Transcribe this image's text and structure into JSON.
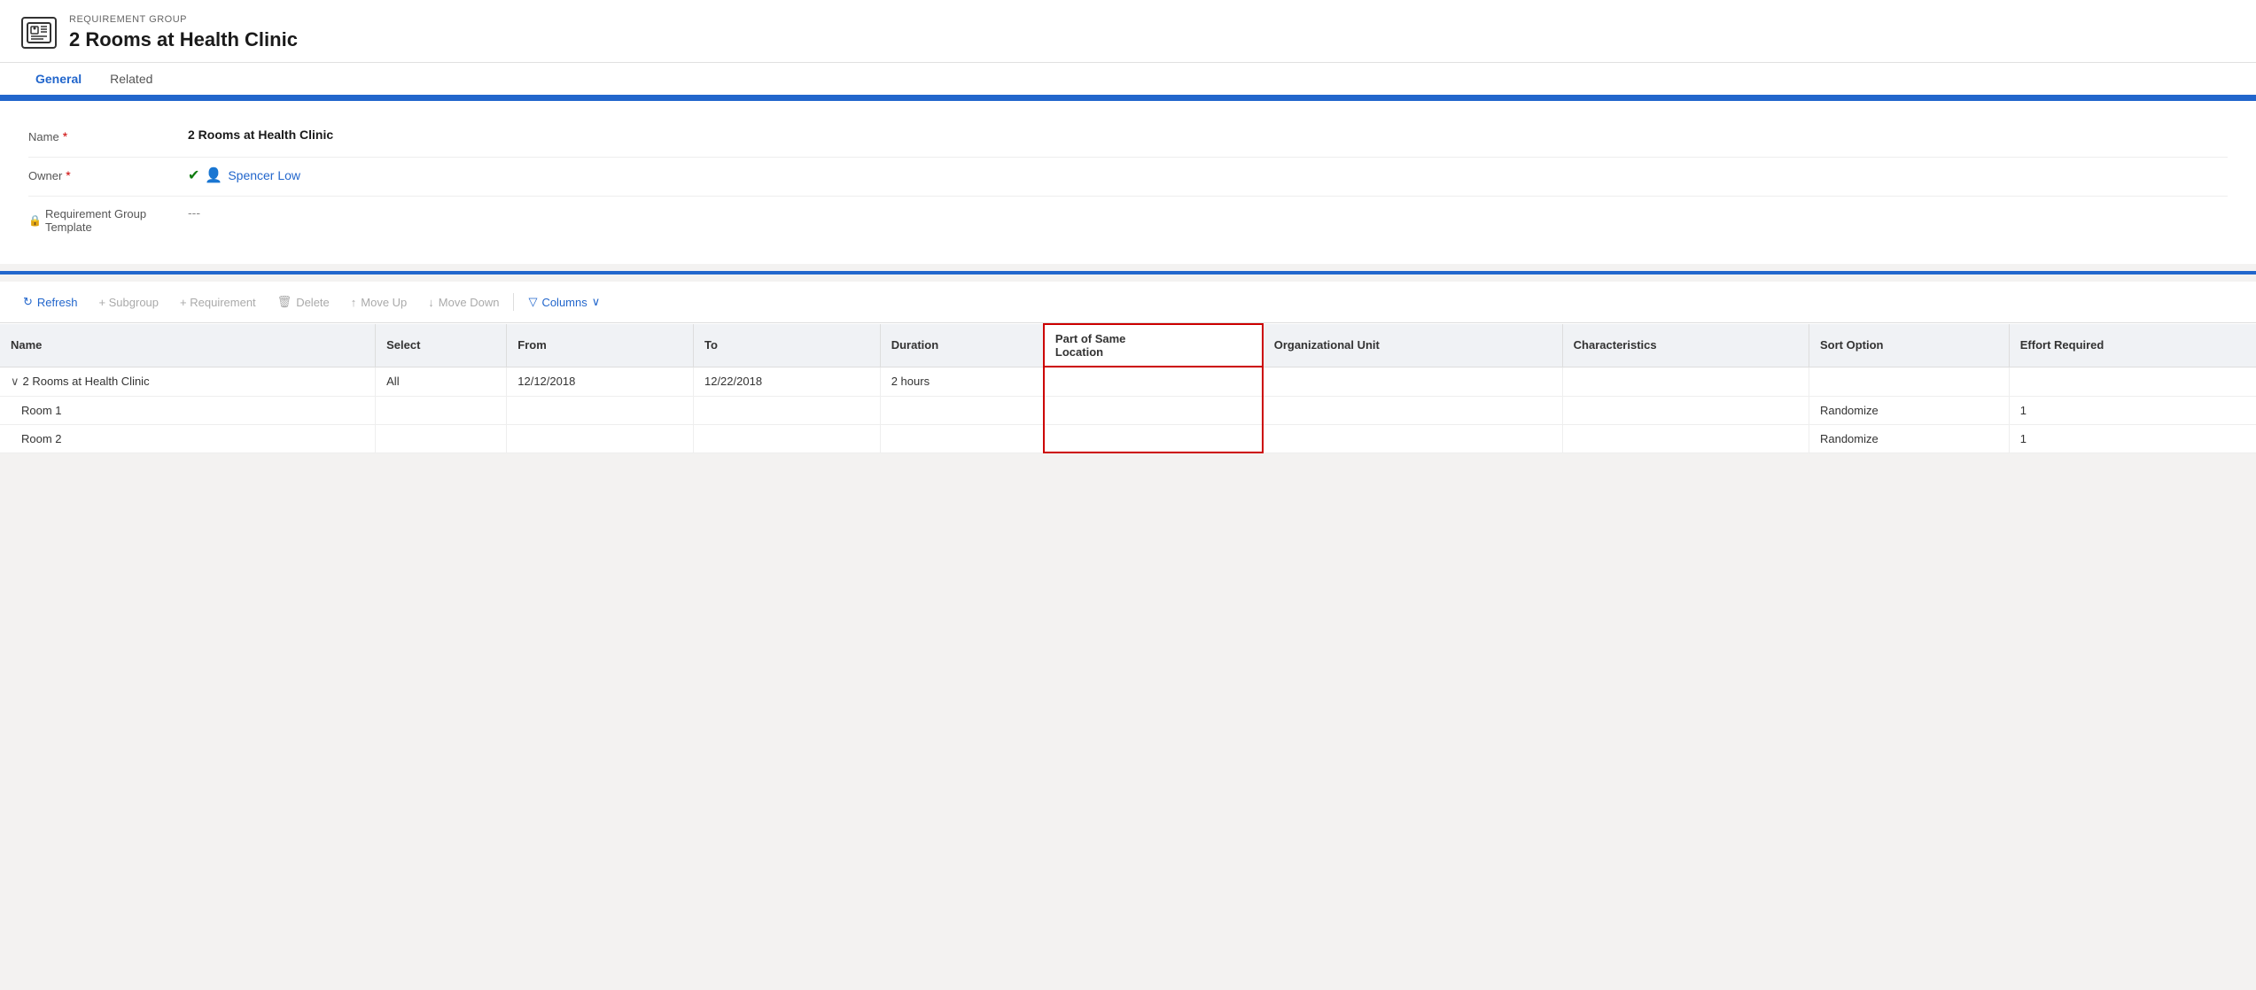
{
  "header": {
    "subtitle": "REQUIREMENT GROUP",
    "title": "2 Rooms at Health Clinic",
    "icon_text": "R="
  },
  "tabs": [
    {
      "label": "General",
      "active": true
    },
    {
      "label": "Related",
      "active": false
    }
  ],
  "form": {
    "fields": [
      {
        "label": "Name",
        "required": true,
        "value": "2 Rooms at Health Clinic",
        "type": "text",
        "locked": false
      },
      {
        "label": "Owner",
        "required": true,
        "value": "Spencer Low",
        "type": "link",
        "locked": false
      },
      {
        "label": "Requirement Group Template",
        "required": false,
        "value": "---",
        "type": "muted",
        "locked": true
      }
    ]
  },
  "toolbar": {
    "refresh_label": "Refresh",
    "subgroup_label": "+ Subgroup",
    "requirement_label": "+ Requirement",
    "delete_label": "Delete",
    "move_up_label": "Move Up",
    "move_down_label": "Move Down",
    "columns_label": "Columns"
  },
  "table": {
    "columns": [
      {
        "key": "name",
        "label": "Name",
        "highlighted": false
      },
      {
        "key": "select",
        "label": "Select",
        "highlighted": false
      },
      {
        "key": "from",
        "label": "From",
        "highlighted": false
      },
      {
        "key": "to",
        "label": "To",
        "highlighted": false
      },
      {
        "key": "duration",
        "label": "Duration",
        "highlighted": false
      },
      {
        "key": "part_of_same",
        "label": "Part of Same\nLocation",
        "highlighted": true
      },
      {
        "key": "org_unit",
        "label": "Organizational Unit",
        "highlighted": false
      },
      {
        "key": "characteristics",
        "label": "Characteristics",
        "highlighted": false
      },
      {
        "key": "sort_option",
        "label": "Sort Option",
        "highlighted": false
      },
      {
        "key": "effort_required",
        "label": "Effort Required",
        "highlighted": false
      }
    ],
    "rows": [
      {
        "name": "2 Rooms at Health Clinic",
        "indent": false,
        "chevron": true,
        "select": "All",
        "from": "12/12/2018",
        "to": "12/22/2018",
        "duration": "2 hours",
        "part_of_same": "",
        "org_unit": "",
        "characteristics": "",
        "sort_option": "",
        "effort_required": ""
      },
      {
        "name": "Room 1",
        "indent": true,
        "chevron": false,
        "select": "",
        "from": "",
        "to": "",
        "duration": "",
        "part_of_same": "",
        "org_unit": "",
        "characteristics": "",
        "sort_option": "Randomize",
        "effort_required": "1"
      },
      {
        "name": "Room 2",
        "indent": true,
        "chevron": false,
        "select": "",
        "from": "",
        "to": "",
        "duration": "",
        "part_of_same": "",
        "org_unit": "",
        "characteristics": "",
        "sort_option": "Randomize",
        "effort_required": "1"
      }
    ]
  }
}
